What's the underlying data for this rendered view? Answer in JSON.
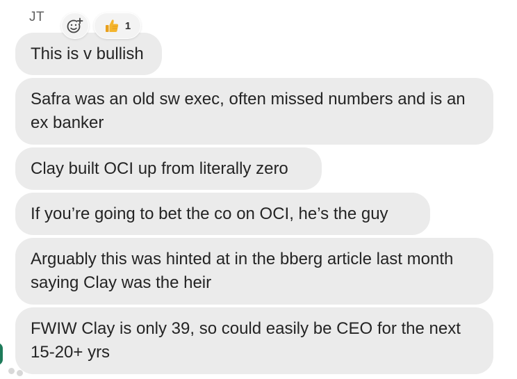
{
  "sender": {
    "name": "JT"
  },
  "reactions": {
    "add_reaction_icon": "add-reaction-icon",
    "thumbs_up_icon": "thumbs-up-icon",
    "thumbs_up_count": "1"
  },
  "messages": [
    {
      "text": "This is v bullish"
    },
    {
      "text": "Safra was an old sw exec, often missed numbers and is an ex banker"
    },
    {
      "text": "Clay built OCI up from literally zero"
    },
    {
      "text": "If you’re going to bet the co on OCI, he’s the guy"
    },
    {
      "text": "Arguably this was hinted at in the bberg article last month saying Clay was the heir"
    },
    {
      "text": "FWIW Clay is only 39, so could easily be CEO for the next 15-20+ yrs"
    }
  ],
  "colors": {
    "bubble_bg": "#ebebeb",
    "text": "#242424",
    "sender_text": "#606060",
    "thumb_yellow": "#f4b52e",
    "presence_green": "#1e7b5a"
  }
}
